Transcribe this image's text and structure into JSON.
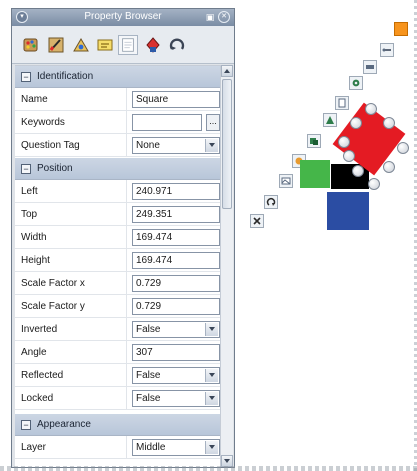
{
  "window": {
    "title": "Property Browser"
  },
  "toolbar": {
    "tools": [
      {
        "icon": "palette-icon"
      },
      {
        "icon": "brush-icon"
      },
      {
        "icon": "fill-icon"
      },
      {
        "icon": "text-style-icon"
      },
      {
        "icon": "page-icon",
        "active": true
      },
      {
        "icon": "shape-icon"
      },
      {
        "icon": "rotate-icon"
      }
    ]
  },
  "sections": {
    "identification": {
      "label": "Identification",
      "rows": {
        "name": {
          "label": "Name",
          "value": "Square"
        },
        "keywords": {
          "label": "Keywords",
          "value": "",
          "button": "..."
        },
        "question_tag": {
          "label": "Question Tag",
          "value": "None"
        }
      }
    },
    "position": {
      "label": "Position",
      "rows": {
        "left": {
          "label": "Left",
          "value": "240.971"
        },
        "top": {
          "label": "Top",
          "value": "249.351"
        },
        "width": {
          "label": "Width",
          "value": "169.474"
        },
        "height": {
          "label": "Height",
          "value": "169.474"
        },
        "scale_x": {
          "label": "Scale Factor x",
          "value": "0.729"
        },
        "scale_y": {
          "label": "Scale Factor y",
          "value": "0.729"
        },
        "inverted": {
          "label": "Inverted",
          "value": "False"
        },
        "angle": {
          "label": "Angle",
          "value": "307"
        },
        "reflected": {
          "label": "Reflected",
          "value": "False"
        },
        "locked": {
          "label": "Locked",
          "value": "False"
        }
      }
    },
    "appearance": {
      "label": "Appearance",
      "rows": {
        "layer": {
          "label": "Layer",
          "value": "Middle"
        }
      }
    }
  },
  "canvas": {
    "colors": {
      "selected_square": "#e41b23",
      "black_square": "#000000",
      "green_square": "#45b649",
      "blue_square": "#2b4da3",
      "orange_chip": "#f7941d"
    }
  }
}
